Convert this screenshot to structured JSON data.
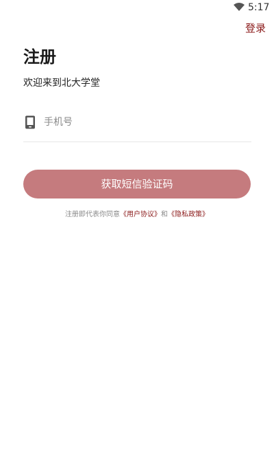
{
  "status_bar": {
    "time": "5:17",
    "wifi_icon": "wifi-icon"
  },
  "header": {
    "login_link": "登录"
  },
  "main": {
    "title": "注册",
    "welcome": "欢迎来到北大学堂",
    "phone_input": {
      "icon": "phone-icon",
      "placeholder": "手机号",
      "value": ""
    },
    "sms_button_label": "获取短信验证码",
    "agreement": {
      "prefix": "注册即代表你同意",
      "user_agreement": "《用户协议》",
      "conjunction": "和",
      "privacy_policy": "《隐私政策》"
    }
  },
  "colors": {
    "accent": "#8b1a1a",
    "button": "#c57b7e"
  }
}
